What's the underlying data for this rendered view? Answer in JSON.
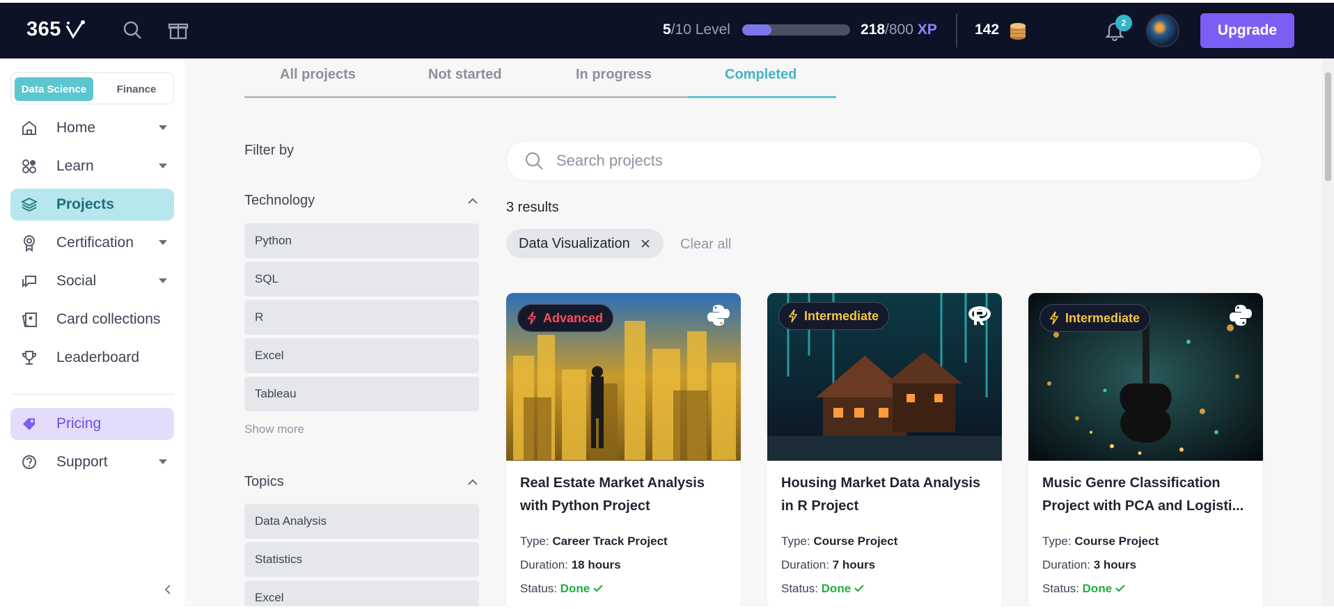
{
  "topbar": {
    "logo": "365",
    "level_current": "5",
    "level_rest": "/10 Level",
    "xp_progress": 0.27,
    "xp_current": "218",
    "xp_total": "/800",
    "xp_label": "XP",
    "coins": "142",
    "notifications": "2",
    "upgrade_label": "Upgrade"
  },
  "sidebar": {
    "tracks": [
      "Data Science",
      "Finance"
    ],
    "items": [
      {
        "label": "Home",
        "icon": "home-icon"
      },
      {
        "label": "Learn",
        "icon": "learn-icon"
      },
      {
        "label": "Projects",
        "icon": "layers-icon"
      },
      {
        "label": "Certification",
        "icon": "certificate-icon"
      },
      {
        "label": "Social",
        "icon": "chat-icon"
      },
      {
        "label": "Card collections",
        "icon": "cards-icon"
      },
      {
        "label": "Leaderboard",
        "icon": "trophy-icon"
      },
      {
        "label": "Pricing",
        "icon": "tag-icon"
      },
      {
        "label": "Support",
        "icon": "help-icon"
      }
    ]
  },
  "tabs": [
    "All projects",
    "Not started",
    "In progress",
    "Completed"
  ],
  "filters": {
    "title": "Filter by",
    "technology_title": "Technology",
    "technology": [
      "Python",
      "SQL",
      "R",
      "Excel",
      "Tableau"
    ],
    "show_more": "Show more",
    "topics_title": "Topics",
    "topics": [
      "Data Analysis",
      "Statistics",
      "Excel"
    ]
  },
  "search": {
    "placeholder": "Search projects"
  },
  "results": "3 results",
  "active_filter": "Data Visualization",
  "clear_all": "Clear all",
  "cards": [
    {
      "level": "Advanced",
      "level_color": "#ff4d5a",
      "tech": "python-icon",
      "title": "Real Estate Market Analysis with Python Project",
      "type_label": "Type:",
      "type": "Career Track Project",
      "duration_label": "Duration:",
      "duration": "18 hours",
      "status_label": "Status:",
      "status": "Done"
    },
    {
      "level": "Intermediate",
      "level_color": "#f5c542",
      "tech": "r-icon",
      "title": "Housing Market Data Analysis in R Project",
      "type_label": "Type:",
      "type": "Course Project",
      "duration_label": "Duration:",
      "duration": "7 hours",
      "status_label": "Status:",
      "status": "Done"
    },
    {
      "level": "Intermediate",
      "level_color": "#f5c542",
      "tech": "python-icon",
      "title": "Music Genre Classification Project with PCA and Logisti...",
      "type_label": "Type:",
      "type": "Course Project",
      "duration_label": "Duration:",
      "duration": "3 hours",
      "status_label": "Status:",
      "status": "Done"
    }
  ]
}
